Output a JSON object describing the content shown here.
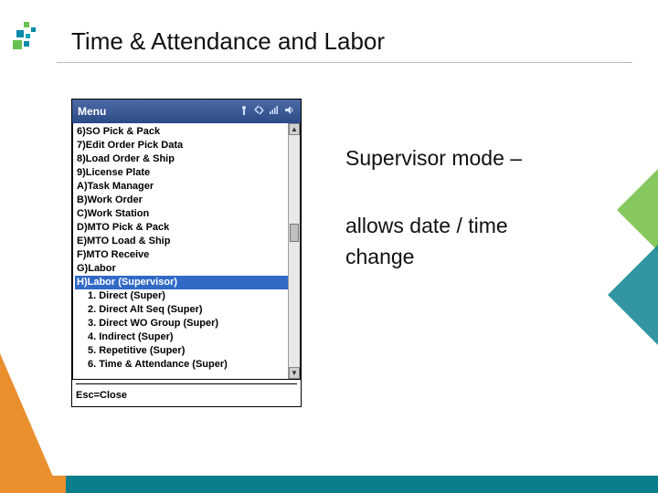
{
  "page": {
    "title": "Time & Attendance and Labor",
    "caption_line1": "Supervisor mode –",
    "caption_line2": "allows date / time",
    "caption_line3": "change"
  },
  "window": {
    "title": "Menu",
    "footer": "Esc=Close",
    "items": [
      {
        "label": "6)SO Pick & Pack"
      },
      {
        "label": "7)Edit Order Pick Data"
      },
      {
        "label": "8)Load Order & Ship"
      },
      {
        "label": "9)License Plate"
      },
      {
        "label": "A)Task Manager"
      },
      {
        "label": "B)Work Order"
      },
      {
        "label": "C)Work Station"
      },
      {
        "label": "D)MTO Pick & Pack"
      },
      {
        "label": "E)MTO Load & Ship"
      },
      {
        "label": "F)MTO Receive"
      },
      {
        "label": "G)Labor"
      },
      {
        "label": "H)Labor (Supervisor)",
        "selected": true
      },
      {
        "label": "1. Direct (Super)",
        "sub": true
      },
      {
        "label": "2. Direct Alt Seq (Super)",
        "sub": true
      },
      {
        "label": "3. Direct WO Group (Super)",
        "sub": true
      },
      {
        "label": "4. Indirect (Super)",
        "sub": true
      },
      {
        "label": "5. Repetitive (Super)",
        "sub": true
      },
      {
        "label": "6. Time & Attendance (Super)",
        "sub": true
      }
    ]
  }
}
